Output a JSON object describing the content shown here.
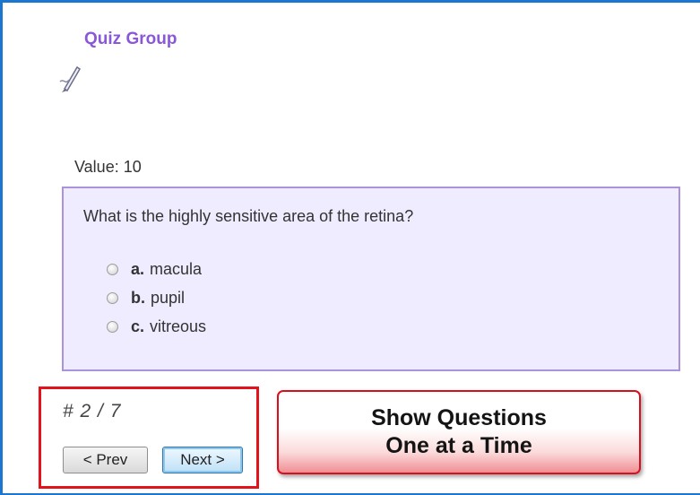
{
  "quiz": {
    "group_title": "Quiz Group",
    "edit_icon": "pen-icon",
    "value_label": "Value: 10",
    "question": "What is the highly sensitive area of the retina?",
    "options": [
      {
        "letter": "a.",
        "text": "macula",
        "selected": false
      },
      {
        "letter": "b.",
        "text": "pupil",
        "selected": false
      },
      {
        "letter": "c.",
        "text": "vitreous",
        "selected": false
      }
    ]
  },
  "navigation": {
    "counter": "# 2 / 7",
    "prev_label": "< Prev",
    "next_label": "Next >"
  },
  "callout": {
    "line1": "Show Questions",
    "line2": "One at a Time"
  },
  "colors": {
    "frame_border": "#1a76cf",
    "title": "#8a57d8",
    "question_bg": "#f0ecff",
    "question_border": "#a994dc",
    "highlight_red": "#e3131b"
  }
}
